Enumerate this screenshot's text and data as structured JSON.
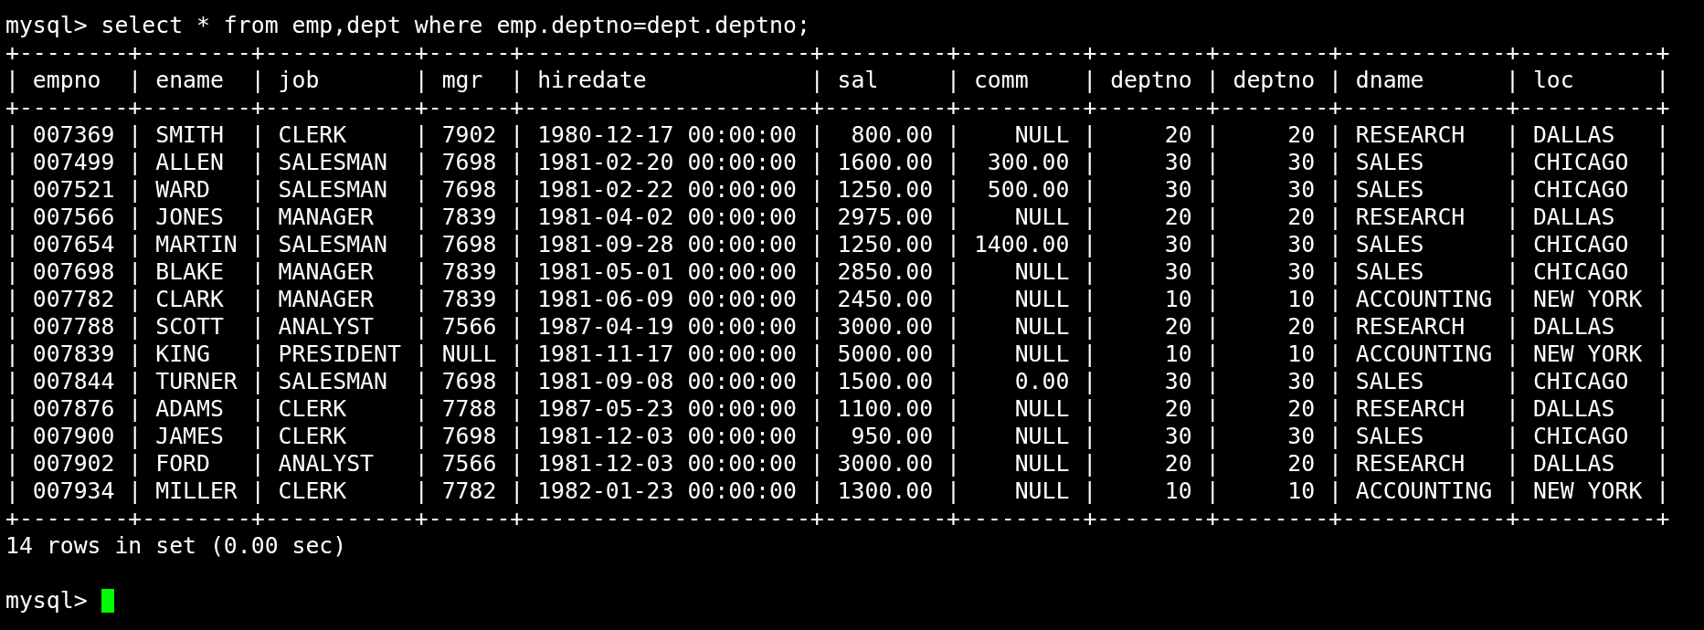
{
  "command_line": {
    "prompt": "mysql>",
    "command": "select * from emp,dept where emp.deptno=dept.deptno;"
  },
  "table": {
    "top_border": "+--------+--------+-----------+------+---------------------+---------+---------+--------+--------+------------+----------+",
    "separator": "|",
    "columns": [
      {
        "name": "empno",
        "kind": "text"
      },
      {
        "name": "ename",
        "kind": "text"
      },
      {
        "name": "job",
        "kind": "text"
      },
      {
        "name": "mgr",
        "kind": "text"
      },
      {
        "name": "hiredate",
        "kind": "text"
      },
      {
        "name": "sal",
        "kind": "number"
      },
      {
        "name": "comm",
        "kind": "number"
      },
      {
        "name": "deptno",
        "kind": "number"
      },
      {
        "name": "deptno",
        "kind": "number"
      },
      {
        "name": "dname",
        "kind": "text"
      },
      {
        "name": "loc",
        "kind": "text"
      }
    ],
    "header_border": "+--------+--------+-----------+------+---------------------+---------+---------+--------+--------+------------+----------+",
    "rows": [
      [
        "007369",
        "SMITH",
        "CLERK",
        "7902",
        "1980-12-17 00:00:00",
        "800.00",
        "NULL",
        "20",
        "20",
        "RESEARCH",
        "DALLAS"
      ],
      [
        "007499",
        "ALLEN",
        "SALESMAN",
        "7698",
        "1981-02-20 00:00:00",
        "1600.00",
        "300.00",
        "30",
        "30",
        "SALES",
        "CHICAGO"
      ],
      [
        "007521",
        "WARD",
        "SALESMAN",
        "7698",
        "1981-02-22 00:00:00",
        "1250.00",
        "500.00",
        "30",
        "30",
        "SALES",
        "CHICAGO"
      ],
      [
        "007566",
        "JONES",
        "MANAGER",
        "7839",
        "1981-04-02 00:00:00",
        "2975.00",
        "NULL",
        "20",
        "20",
        "RESEARCH",
        "DALLAS"
      ],
      [
        "007654",
        "MARTIN",
        "SALESMAN",
        "7698",
        "1981-09-28 00:00:00",
        "1250.00",
        "1400.00",
        "30",
        "30",
        "SALES",
        "CHICAGO"
      ],
      [
        "007698",
        "BLAKE",
        "MANAGER",
        "7839",
        "1981-05-01 00:00:00",
        "2850.00",
        "NULL",
        "30",
        "30",
        "SALES",
        "CHICAGO"
      ],
      [
        "007782",
        "CLARK",
        "MANAGER",
        "7839",
        "1981-06-09 00:00:00",
        "2450.00",
        "NULL",
        "10",
        "10",
        "ACCOUNTING",
        "NEW YORK"
      ],
      [
        "007788",
        "SCOTT",
        "ANALYST",
        "7566",
        "1987-04-19 00:00:00",
        "3000.00",
        "NULL",
        "20",
        "20",
        "RESEARCH",
        "DALLAS"
      ],
      [
        "007839",
        "KING",
        "PRESIDENT",
        "NULL",
        "1981-11-17 00:00:00",
        "5000.00",
        "NULL",
        "10",
        "10",
        "ACCOUNTING",
        "NEW YORK"
      ],
      [
        "007844",
        "TURNER",
        "SALESMAN",
        "7698",
        "1981-09-08 00:00:00",
        "1500.00",
        "0.00",
        "30",
        "30",
        "SALES",
        "CHICAGO"
      ],
      [
        "007876",
        "ADAMS",
        "CLERK",
        "7788",
        "1987-05-23 00:00:00",
        "1100.00",
        "NULL",
        "20",
        "20",
        "RESEARCH",
        "DALLAS"
      ],
      [
        "007900",
        "JAMES",
        "CLERK",
        "7698",
        "1981-12-03 00:00:00",
        "950.00",
        "NULL",
        "30",
        "30",
        "SALES",
        "CHICAGO"
      ],
      [
        "007902",
        "FORD",
        "ANALYST",
        "7566",
        "1981-12-03 00:00:00",
        "3000.00",
        "NULL",
        "20",
        "20",
        "RESEARCH",
        "DALLAS"
      ],
      [
        "007934",
        "MILLER",
        "CLERK",
        "7782",
        "1982-01-23 00:00:00",
        "1300.00",
        "NULL",
        "10",
        "10",
        "ACCOUNTING",
        "NEW YORK"
      ]
    ],
    "bottom_border": "+--------+--------+-----------+------+---------------------+---------+---------+--------+--------+------------+----------+"
  },
  "summary": "14 rows in set (0.00 sec)",
  "prompt_line": {
    "prompt": "mysql>",
    "cursor": true
  }
}
